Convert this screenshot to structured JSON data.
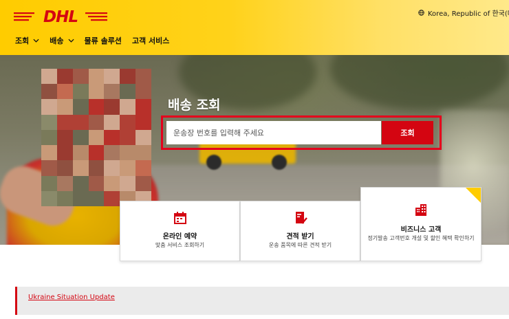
{
  "brand": {
    "logo_text": "DHL",
    "color_yellow": "#ffcc00",
    "color_red": "#d40511"
  },
  "header": {
    "locale": "Korea, Republic of 한국(대한민",
    "nav": [
      {
        "label": "조회",
        "has_dropdown": true
      },
      {
        "label": "배송",
        "has_dropdown": true
      },
      {
        "label": "물류 솔루션",
        "has_dropdown": false
      },
      {
        "label": "고객 서비스",
        "has_dropdown": false
      }
    ]
  },
  "hero": {
    "title": "배송 조회",
    "search": {
      "placeholder": "운송장 번호를 입력해 주세요",
      "button_label": "조회"
    }
  },
  "cards": [
    {
      "icon": "calendar-icon",
      "title": "온라인 예약",
      "description": "맞춤 서비스 조회하기"
    },
    {
      "icon": "quote-document-icon",
      "title": "견적 받기",
      "description": "운송 품목에 따른 견적 받기"
    },
    {
      "icon": "building-icon",
      "title": "비즈니스 고객",
      "description": "정기발송 고객번호 개설 및 할인 혜택 확인하기"
    }
  ],
  "alert": {
    "link_text": "Ukraine Situation Update"
  }
}
